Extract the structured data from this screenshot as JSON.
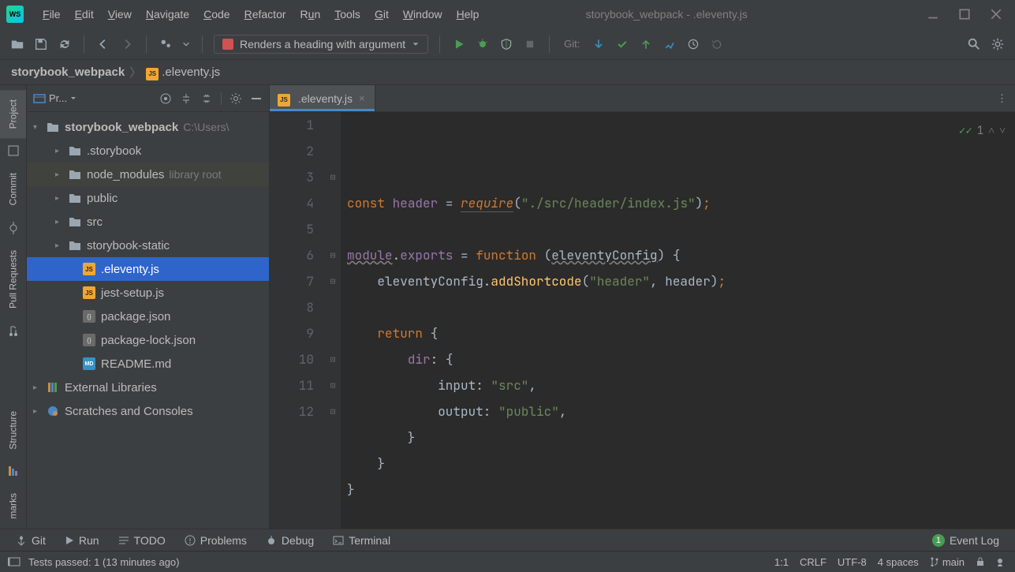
{
  "window": {
    "title": "storybook_webpack - .eleventy.js"
  },
  "menu": {
    "file": "File",
    "edit": "Edit",
    "view": "View",
    "navigate": "Navigate",
    "code": "Code",
    "refactor": "Refactor",
    "run": "Run",
    "tools": "Tools",
    "git": "Git",
    "window": "Window",
    "help": "Help"
  },
  "toolbar": {
    "run_config_label": "Renders a heading with argument",
    "git_label": "Git:"
  },
  "breadcrumb": {
    "root": "storybook_webpack",
    "file": ".eleventy.js"
  },
  "left_gutter": [
    "Project",
    "Commit",
    "Pull Requests",
    "Structure",
    "marks"
  ],
  "project_panel": {
    "title": "Pr...",
    "root": {
      "name": "storybook_webpack",
      "path": "C:\\Users\\"
    }
  },
  "tree": {
    "folders": [
      {
        "name": ".storybook",
        "depth": 1
      },
      {
        "name": "node_modules",
        "depth": 1,
        "tail": "library root",
        "lib": true
      },
      {
        "name": "public",
        "depth": 1
      },
      {
        "name": "src",
        "depth": 1
      },
      {
        "name": "storybook-static",
        "depth": 1
      }
    ],
    "files": [
      {
        "name": ".eleventy.js",
        "type": "js",
        "sel": true
      },
      {
        "name": "jest-setup.js",
        "type": "js"
      },
      {
        "name": "package.json",
        "type": "json"
      },
      {
        "name": "package-lock.json",
        "type": "json"
      },
      {
        "name": "README.md",
        "type": "md"
      }
    ],
    "bottom": [
      {
        "name": "External Libraries",
        "icon": "lib"
      },
      {
        "name": "Scratches and Consoles",
        "icon": "scratch"
      }
    ]
  },
  "tabs": [
    {
      "name": ".eleventy.js",
      "active": true
    }
  ],
  "editor": {
    "lines": [
      {
        "n": 1,
        "html": "<span class='kw'>const</span> <span class='prop'>header</span> = <span class='req ul'>require</span>(<span class='str'>\"./src/header/index.js\"</span>)<span class='semi'>;</span>"
      },
      {
        "n": 2,
        "html": ""
      },
      {
        "n": 3,
        "html": "<span class='ul-wavy'><span class='prop'>module</span></span>.<span class='prop'>exports</span> = <span class='kw'>function </span>(<span class='param ul-wavy'>eleventyConfig</span>) {"
      },
      {
        "n": 4,
        "html": "    eleventyConfig.<span class='fn'>addShortcode</span>(<span class='str'>\"header\"</span>, header)<span class='semi'>;</span>"
      },
      {
        "n": 5,
        "html": ""
      },
      {
        "n": 6,
        "html": "    <span class='kw'>return</span> {"
      },
      {
        "n": 7,
        "html": "        <span class='prop'>dir</span>: {"
      },
      {
        "n": 8,
        "html": "            input: <span class='str'>\"src\"</span>,"
      },
      {
        "n": 9,
        "html": "            output: <span class='str'>\"public\"</span>,"
      },
      {
        "n": 10,
        "html": "        }"
      },
      {
        "n": 11,
        "html": "    }"
      },
      {
        "n": 12,
        "html": "}"
      }
    ],
    "inspection_count": "1"
  },
  "bottom": {
    "git": "Git",
    "run": "Run",
    "todo": "TODO",
    "problems": "Problems",
    "debug": "Debug",
    "terminal": "Terminal",
    "eventlog": "Event Log",
    "event_badge": "1"
  },
  "status": {
    "msg": "Tests passed: 1 (13 minutes ago)",
    "pos": "1:1",
    "lf": "CRLF",
    "enc": "UTF-8",
    "indent": "4 spaces",
    "branch": "main"
  }
}
